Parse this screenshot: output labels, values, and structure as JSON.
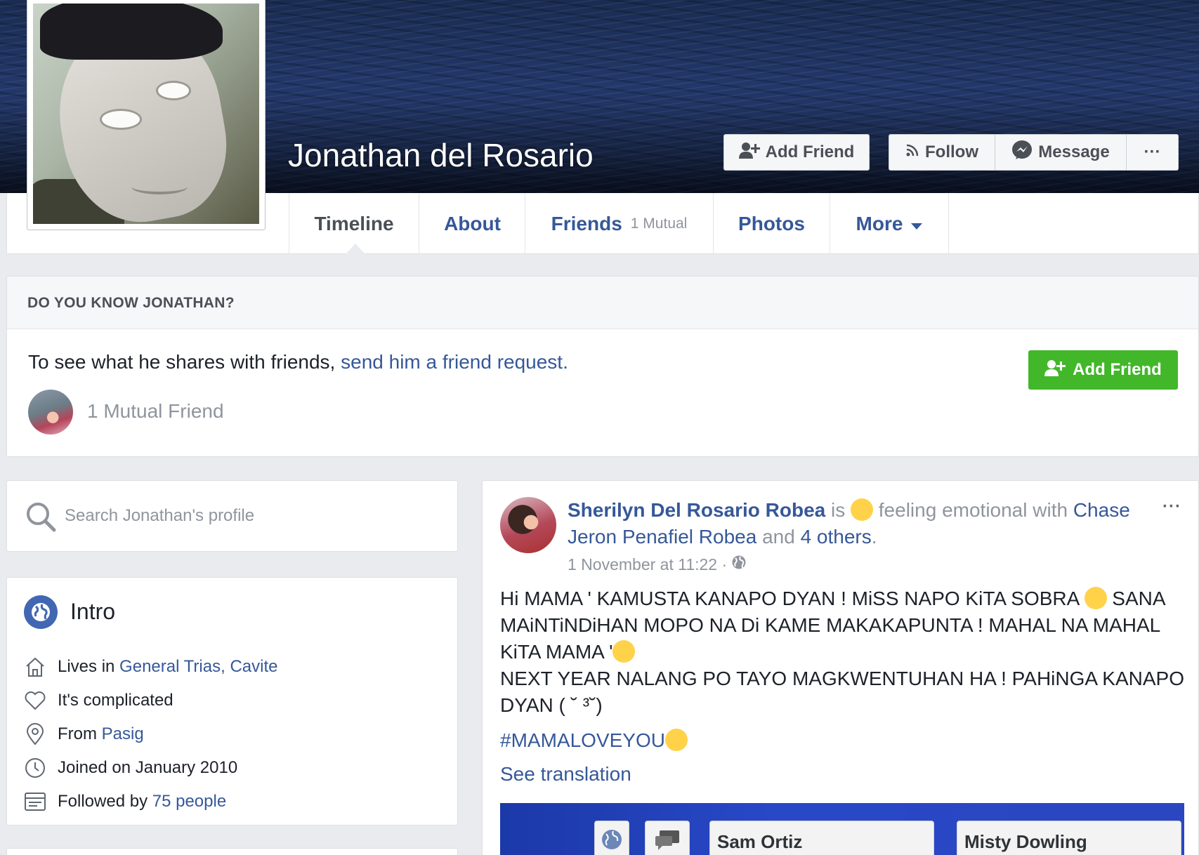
{
  "profile": {
    "name": "Jonathan del Rosario"
  },
  "cover_actions": {
    "add_friend": "Add Friend",
    "follow": "Follow",
    "message": "Message",
    "more": "···"
  },
  "tabs": [
    {
      "label": "Timeline"
    },
    {
      "label": "About"
    },
    {
      "label": "Friends",
      "sub": "1 Mutual"
    },
    {
      "label": "Photos"
    },
    {
      "label": "More"
    }
  ],
  "know_box": {
    "heading": "DO YOU KNOW JONATHAN?",
    "text_plain": "To see what he shares with friends, ",
    "text_link": "send him a friend request.",
    "mutual": "1 Mutual Friend",
    "add_friend": "Add Friend"
  },
  "search": {
    "placeholder": "Search Jonathan's profile"
  },
  "intro": {
    "title": "Intro",
    "items": [
      {
        "icon": "home-icon",
        "prefix": "Lives in ",
        "link": "General Trias, Cavite"
      },
      {
        "icon": "heart-icon",
        "prefix": "It's complicated",
        "link": ""
      },
      {
        "icon": "location-pin-icon",
        "prefix": "From ",
        "link": "Pasig"
      },
      {
        "icon": "clock-icon",
        "prefix": "Joined on January 2010",
        "link": ""
      },
      {
        "icon": "rss-icon",
        "prefix": "Followed by ",
        "link": "75 people"
      }
    ]
  },
  "post": {
    "author": "Sherilyn Del Rosario Robea",
    "is": " is ",
    "feeling": " feeling emotional with ",
    "with_name": "Chase Jeron Penafiel Robea",
    "and": " and ",
    "others": "4 others",
    "period": ".",
    "timestamp": "1 November at 11:22 ·",
    "menu": "···",
    "body_line1": "Hi MAMA ' KAMUSTA KANAPO DYAN ! MiSS NAPO KiTA SOBRA ",
    "body_line2": " SANA MAiNTiNDiHAN MOPO NA Di KAME MAKAKAPUNTA ! MAHAL NA MAHAL KiTA MAMA '",
    "body_line3": "NEXT YEAR NALANG PO TAYO MAGKWENTUHAN HA ! PAHiNGA KANAPO DYAN ( ˘ ³˘)",
    "hashtag": "#MAMALOVEYOU",
    "see_translation": "See translation",
    "media_tiles": [
      "Sam Ortiz",
      "Misty Dowling"
    ]
  },
  "colors": {
    "link": "#365899",
    "green": "#42b72a",
    "background": "#e9ebee"
  }
}
